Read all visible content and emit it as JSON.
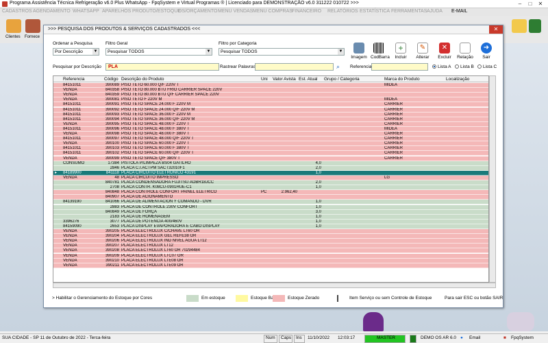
{
  "window": {
    "title": "Programa Assistência Técnica Refrigeração v6.0 Plus WhatsApp - FpqSystem e Virtual Programas ® | Licenciado para  DEMONSTRAÇÃO v6.0 311222 010722 >>>"
  },
  "menu": [
    "CADASTROS",
    "AGENDAMENTO",
    "WHATSAPP",
    "APARELHOS",
    "PRODUTO/ESTOQUE",
    "OS/ORÇAMENTO",
    "MENU VENDAS",
    "MENU COMPRAS",
    "FINANCEIRO",
    "RELATÓRIOS",
    "ESTATÍSTICA",
    "FERRAMENTAS",
    "AJUDA",
    "E-MAIL"
  ],
  "toolbar": {
    "clientes": "Clientes",
    "fornece": "Fornece"
  },
  "dialog": {
    "title": ">>>  PESQUISA DOS PRODUTOS & SERVIÇOS CADASTRADOS  <<<",
    "ordenar_label": "Ordenar a Pesquisa",
    "ordenar_value": "Por Descrição",
    "filtro_geral_label": "Filtro Geral",
    "filtro_geral_value": "Pesquisar TODOS",
    "filtro_cat_label": "Filtro por Categoria",
    "filtro_cat_value": "Pesquisar TODOS",
    "pesq_desc_label": "Pesquisar por Descrição",
    "pesq_desc_value": "PLA",
    "rastrear_label": "Rastrear Palavras",
    "rastrear_value": "",
    "referencia_label": "Referencia",
    "referencia_value": "",
    "buttons": [
      "Imagem",
      "CodBarra",
      "Incluir",
      "Alterar",
      "Excluir",
      "Relação",
      "Sair"
    ],
    "radios": [
      "Lista A",
      "Lista B",
      "Lista C"
    ]
  },
  "grid": {
    "headers": [
      "Referencia",
      "Código",
      "Descrição do Produto",
      "Uni",
      "Valor Avista",
      "Est. Atual",
      "Grupo / Categoria",
      "Marca do Produto",
      "Localização"
    ],
    "rows": [
      {
        "ref": "84151011",
        "cod": "390089",
        "desc": "PISO TETO 60.000 Q/F 220V T",
        "uni": "",
        "val": "",
        "est": "",
        "grp": "",
        "marca": "MIDEA",
        "c": "red"
      },
      {
        "ref": "VENDA",
        "cod": "840358",
        "desc": "PISO TETO 80.000 BTU FRIO CARRIER SPACE 220V",
        "uni": "",
        "val": "",
        "est": "",
        "grp": "",
        "marca": "",
        "c": "red"
      },
      {
        "ref": "VENDA",
        "cod": "840359",
        "desc": "PISO TETO 80.000 BTU Q/F CARRIER SPACE 220V",
        "uni": "",
        "val": "",
        "est": "",
        "grp": "",
        "marca": "",
        "c": "red"
      },
      {
        "ref": "VENDA",
        "cod": "390081",
        "desc": "PISO TETO F 220V M",
        "uni": "",
        "val": "",
        "est": "",
        "grp": "",
        "marca": "MIDEA",
        "c": "red"
      },
      {
        "ref": "84151011",
        "cod": "390091",
        "desc": "PISO TETO SPACE 24.000 F 220V M",
        "uni": "",
        "val": "",
        "est": "",
        "grp": "",
        "marca": "CARRIER",
        "c": "red"
      },
      {
        "ref": "84151011",
        "cod": "390092",
        "desc": "PISO TETO SPACE 24.000 Q/F 220V M",
        "uni": "",
        "val": "",
        "est": "",
        "grp": "",
        "marca": "CARRIER",
        "c": "red"
      },
      {
        "ref": "84151011",
        "cod": "390093",
        "desc": "PISO TETO SPACE 36.000 F 220V M",
        "uni": "",
        "val": "",
        "est": "",
        "grp": "",
        "marca": "CARRIER",
        "c": "red"
      },
      {
        "ref": "84151011",
        "cod": "390094",
        "desc": "PISO TETO SPACE 36.000 Q/F 220V M",
        "uni": "",
        "val": "",
        "est": "",
        "grp": "",
        "marca": "CARRIER",
        "c": "red"
      },
      {
        "ref": "VENDA",
        "cod": "390095",
        "desc": "PISO TETO SPACE 48.000 F 220V T",
        "uni": "",
        "val": "",
        "est": "",
        "grp": "",
        "marca": "CARRIER",
        "c": "red"
      },
      {
        "ref": "84151011",
        "cod": "390096",
        "desc": "PISO TETO SPACE 48.000 F 380V T",
        "uni": "",
        "val": "",
        "est": "",
        "grp": "",
        "marca": "MIDEA",
        "c": "red"
      },
      {
        "ref": "VENDA",
        "cod": "390098",
        "desc": "PISO TETO SPACE 48.000 F 380V T",
        "uni": "",
        "val": "",
        "est": "",
        "grp": "",
        "marca": "CARRIER",
        "c": "red"
      },
      {
        "ref": "84151011",
        "cod": "390097",
        "desc": "PISO TETO SPACE 48.000 Q/F 220V T",
        "uni": "",
        "val": "",
        "est": "",
        "grp": "",
        "marca": "CARRIER",
        "c": "red"
      },
      {
        "ref": "VENDA",
        "cod": "390100",
        "desc": "PISO TETO SPACE 60.000 F 220V T",
        "uni": "",
        "val": "",
        "est": "",
        "grp": "",
        "marca": "CARRIER",
        "c": "red"
      },
      {
        "ref": "84151011",
        "cod": "390103",
        "desc": "PISO TETO SPACE 60.000 F 380V T",
        "uni": "",
        "val": "",
        "est": "",
        "grp": "",
        "marca": "CARRIER",
        "c": "red"
      },
      {
        "ref": "84151011",
        "cod": "390102",
        "desc": "PISO TETO SPACE 60.000 Q/F 220V T",
        "uni": "",
        "val": "",
        "est": "",
        "grp": "",
        "marca": "CARRIER",
        "c": "red"
      },
      {
        "ref": "VENDA",
        "cod": "390099",
        "desc": "PISO TETO SPACE Q/F 380V T",
        "uni": "",
        "val": "",
        "est": "",
        "grp": "",
        "marca": "CARRIER",
        "c": "red"
      },
      {
        "ref": "CONSUMO",
        "cod": "17384",
        "desc": "PISTOLA P/LIMPEZA BS04 GATILHO",
        "uni": "",
        "val": "",
        "est": "4,0",
        "grp": "",
        "marca": "",
        "c": "green"
      },
      {
        "ref": "",
        "cod": "2846",
        "desc": "PLACA C.I.ACTPM SACT32010F1",
        "uni": "",
        "val": "",
        "est": "2,0",
        "grp": "",
        "marca": "",
        "c": "green"
      },
      {
        "ref": "84189900",
        "cod": "841118",
        "desc": "PLACA CIRCUITO ELETRONICO 43191",
        "uni": "",
        "val": "",
        "est": "1,0",
        "grp": "",
        "marca": "",
        "c": "sel"
      },
      {
        "ref": "VENDA",
        "cod": "48",
        "desc": "PLACA CIRCUITO IMPRESSO",
        "uni": "",
        "val": "",
        "est": "",
        "grp": "",
        "marca": "LG",
        "c": "red"
      },
      {
        "ref": "",
        "cod": "840781",
        "desc": "PLACA CONDENSADORA FUJITSU AOBR18JCC",
        "uni": "",
        "val": "",
        "est": "2,0",
        "grp": "",
        "marca": "",
        "c": "green"
      },
      {
        "ref": "",
        "cod": "2708",
        "desc": "PLACA CONTR. K08CU-0901HUE-C1",
        "uni": "",
        "val": "",
        "est": "1,0",
        "grp": "",
        "marca": "",
        "c": "green"
      },
      {
        "ref": "",
        "cod": "840848",
        "desc": "PLACA CONTROLE CONFORT PAINEL ELETRICO",
        "uni": "PC",
        "val": "2.962,40",
        "est": "",
        "grp": "",
        "marca": "",
        "c": "red"
      },
      {
        "ref": "",
        "cod": "840907",
        "desc": "PLACA DE ACIONAMENTO",
        "uni": "",
        "val": "",
        "est": "",
        "grp": "",
        "marca": "",
        "c": "red"
      },
      {
        "ref": "84139190",
        "cod": "841066",
        "desc": "PLACA DE ALIMENTACION Y COMANDO - DVR",
        "uni": "",
        "val": "",
        "est": "1,0",
        "grp": "",
        "marca": "",
        "c": "green"
      },
      {
        "ref": "",
        "cod": "2883",
        "desc": "PLACA DE CONTROLE 230V CONFORT",
        "uni": "",
        "val": "",
        "est": "1,0",
        "grp": "",
        "marca": "",
        "c": "green"
      },
      {
        "ref": "",
        "cod": "840849",
        "desc": "PLACA DE FORÇA",
        "uni": "",
        "val": "",
        "est": "3,0",
        "grp": "",
        "marca": "",
        "c": "green"
      },
      {
        "ref": "",
        "cod": "2183",
        "desc": "PLACA DE HOMENAGEM",
        "uni": "",
        "val": "",
        "est": "1,0",
        "grp": "",
        "marca": "",
        "c": "green"
      },
      {
        "ref": "3396276",
        "cod": "3077",
        "desc": "PLACA DE POTENCIA 400/460V",
        "uni": "",
        "val": "",
        "est": "1,0",
        "grp": "",
        "marca": "",
        "c": "green"
      },
      {
        "ref": "84159090",
        "cod": "2653",
        "desc": "PLACA DISPLAY EVAPORADORA E CABO DISPLAY",
        "uni": "",
        "val": "",
        "est": "1,0",
        "grp": "",
        "marca": "",
        "c": "green"
      },
      {
        "ref": "VENDA",
        "cod": "390205",
        "desc": "PLACA ELECTROLUX C/CHAVE LT60 OR",
        "uni": "",
        "val": "",
        "est": "",
        "grp": "",
        "marca": "",
        "c": "red"
      },
      {
        "ref": "VENDA",
        "cod": "390204",
        "desc": "PLACA ELECTROLUX GEL REFE38 OR",
        "uni": "",
        "val": "",
        "est": "",
        "grp": "",
        "marca": "",
        "c": "red"
      },
      {
        "ref": "VENDA",
        "cod": "390206",
        "desc": "PLACA ELECTROLUX IND NIVEL AGUA LT12",
        "uni": "",
        "val": "",
        "est": "",
        "grp": "",
        "marca": "",
        "c": "red"
      },
      {
        "ref": "VENDA",
        "cod": "390207",
        "desc": "PLACA ELECTROLUX LT12",
        "uni": "",
        "val": "",
        "est": "",
        "grp": "",
        "marca": "",
        "c": "red"
      },
      {
        "ref": "VENDA",
        "cod": "390208",
        "desc": "PLACA ELECTROLUX LT60 OR 70294484",
        "uni": "",
        "val": "",
        "est": "",
        "grp": "",
        "marca": "",
        "c": "red"
      },
      {
        "ref": "VENDA",
        "cod": "390209",
        "desc": "PLACA ELECTROLUX LTC07 OR",
        "uni": "",
        "val": "",
        "est": "",
        "grp": "",
        "marca": "",
        "c": "red"
      },
      {
        "ref": "VENDA",
        "cod": "390210",
        "desc": "PLACA ELECTROLUX LTE08 OR",
        "uni": "",
        "val": "",
        "est": "",
        "grp": "",
        "marca": "",
        "c": "red"
      },
      {
        "ref": "VENDA",
        "cod": "390211",
        "desc": "PLACA ELECTROLUX LTE09 OR",
        "uni": "",
        "val": "",
        "est": "",
        "grp": "",
        "marca": "",
        "c": "red"
      }
    ]
  },
  "legend": {
    "habilitar": ">  Habilitar o Gerenciamento do Estoque por Cores",
    "em_estoque": "Em estoque",
    "estoque_baixo": "Estoque Baixo",
    "estoque_zerado": "Estoque Zerado",
    "item_servico": "Item Serviço ou sem Controle de Estoque",
    "sair_hint": "Para sair ESC ou botão SAIR"
  },
  "colors": {
    "red": "#f4b8b8",
    "green": "#c9dcc9",
    "sel": "#1a7a7a",
    "yellow": "#fff9a0"
  },
  "status": {
    "city_date": "SUA CIDADE - SP 11 de Outubro de 2022 - Terca-feira",
    "num": "Num",
    "caps": "Caps",
    "ins": "Ins",
    "date": "11/10/2022",
    "time": "12:03:17",
    "master": "MASTER",
    "demo": "DEMO OS AR 6.0",
    "email": "Email",
    "fpq": "FpqSystem"
  }
}
